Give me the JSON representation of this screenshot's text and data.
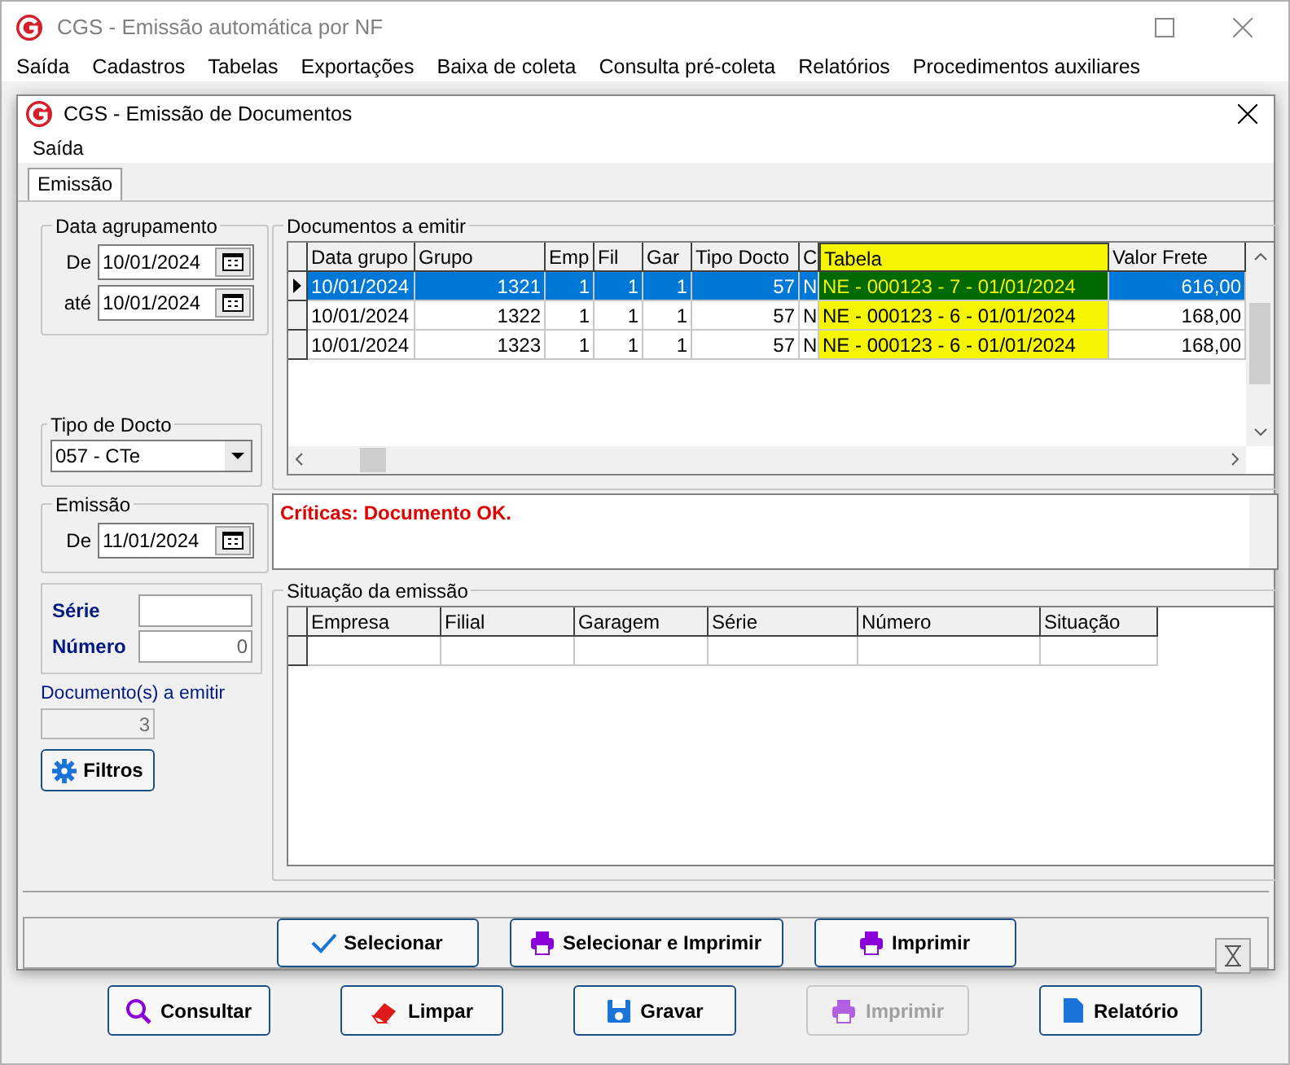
{
  "window": {
    "title": "CGS - Emissão automática por NF",
    "menu": [
      "Saída",
      "Cadastros",
      "Tabelas",
      "Exportações",
      "Baixa de coleta",
      "Consulta pré-coleta",
      "Relatórios",
      "Procedimentos auxiliares"
    ]
  },
  "dialog": {
    "title": "CGS - Emissão de Documentos",
    "menu": [
      "Saída"
    ],
    "tabs": [
      {
        "label": "Emissão",
        "selected": true
      }
    ],
    "grouping": {
      "title": "Data agrupamento",
      "from_label": "De",
      "from": "10/01/2024",
      "to_label": "até",
      "to": "10/01/2024"
    },
    "doc_type": {
      "title": "Tipo de Docto",
      "value": "057 - CTe"
    },
    "issue": {
      "title": "Emissão",
      "from_label": "De",
      "from": "11/01/2024"
    },
    "series": {
      "label": "Série",
      "number_label": "Número",
      "number": "0"
    },
    "to_issue": {
      "label": "Documento(s) a emitir",
      "value": "3"
    },
    "filter_button": "Filtros",
    "documents": {
      "title": "Documentos a emitir",
      "columns": [
        {
          "label": "Data grupo",
          "highlighted": false
        },
        {
          "label": "Grupo",
          "highlighted": false
        },
        {
          "label": "Emp",
          "highlighted": false
        },
        {
          "label": "Fil",
          "highlighted": false
        },
        {
          "label": "Gar",
          "highlighted": false
        },
        {
          "label": "Tipo Docto",
          "highlighted": false
        },
        {
          "label": "C",
          "highlighted": false
        },
        {
          "label": "Tabela",
          "highlighted": true
        },
        {
          "label": "Valor Frete",
          "highlighted": false
        }
      ],
      "rows": [
        {
          "selected": true,
          "cells": [
            "10/01/2024",
            "1321",
            "1",
            "1",
            "1",
            "57",
            "N",
            "NE - 000123 - 7 - 01/01/2024",
            "616,00"
          ]
        },
        {
          "selected": false,
          "cells": [
            "10/01/2024",
            "1322",
            "1",
            "1",
            "1",
            "57",
            "N",
            "NE - 000123 - 6 - 01/01/2024",
            "168,00"
          ]
        },
        {
          "selected": false,
          "cells": [
            "10/01/2024",
            "1323",
            "1",
            "1",
            "1",
            "57",
            "N",
            "NE - 000123 - 6 - 01/01/2024",
            "168,00"
          ]
        }
      ]
    },
    "critique": "Críticas: Documento OK.",
    "status": {
      "title": "Situação da emissão",
      "columns": [
        "Empresa",
        "Filial",
        "Garagem",
        "Série",
        "Número",
        "Situação"
      ]
    },
    "buttons": [
      "Selecionar",
      "Selecionar e Imprimir",
      "Imprimir"
    ]
  },
  "footer_buttons": [
    {
      "label": "Consultar",
      "disabled": false
    },
    {
      "label": "Limpar",
      "disabled": false
    },
    {
      "label": "Gravar",
      "disabled": false
    },
    {
      "label": "Imprimir",
      "disabled": true
    },
    {
      "label": "Relatório",
      "disabled": false
    }
  ]
}
